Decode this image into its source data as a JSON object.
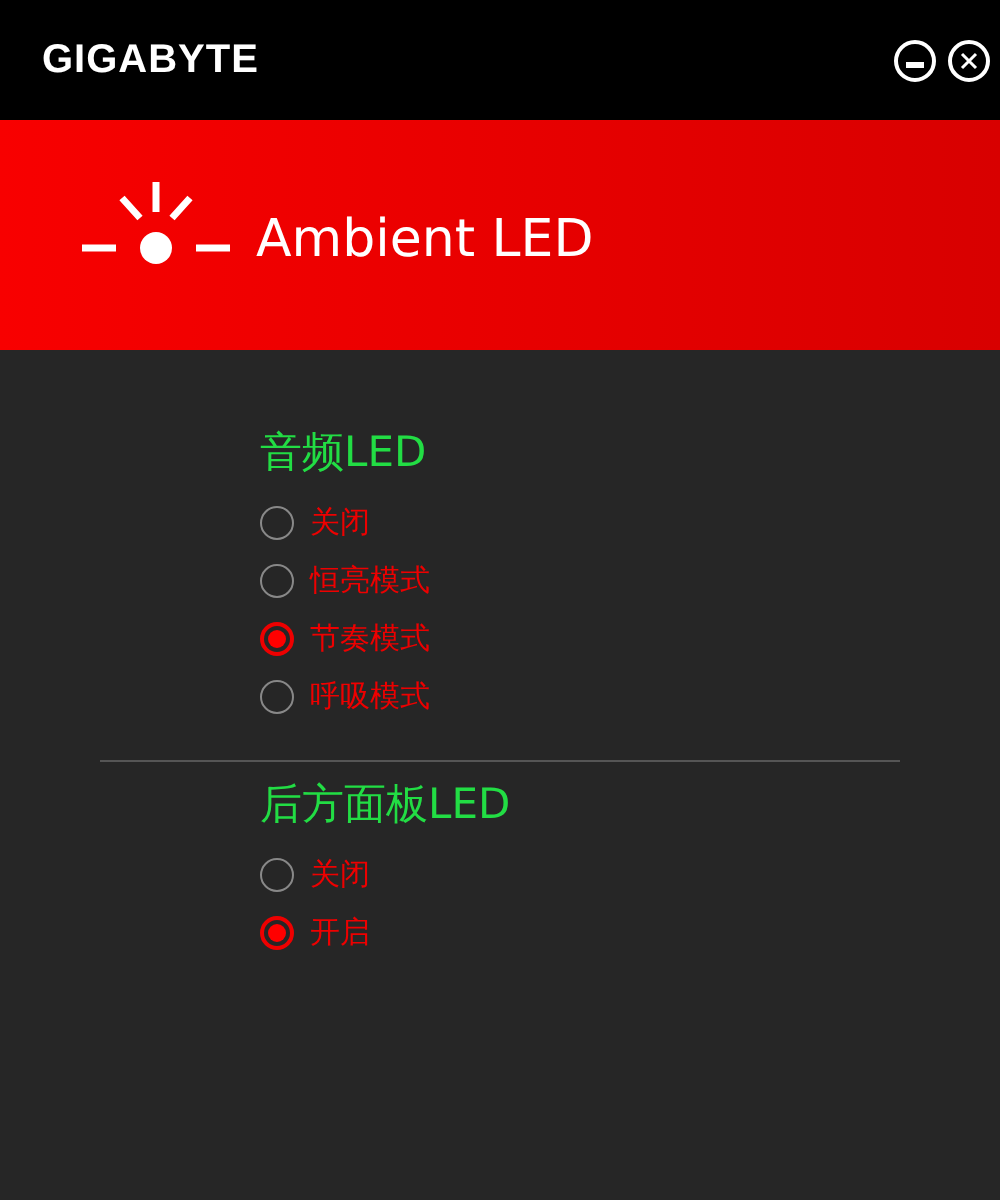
{
  "header": {
    "logo": "GIGABYTE"
  },
  "banner": {
    "title": "Ambient LED"
  },
  "sections": [
    {
      "title": "音频LED",
      "options": [
        {
          "label": "关闭",
          "selected": false
        },
        {
          "label": "恒亮模式",
          "selected": false
        },
        {
          "label": "节奏模式",
          "selected": true
        },
        {
          "label": "呼吸模式",
          "selected": false
        }
      ]
    },
    {
      "title": "后方面板LED",
      "options": [
        {
          "label": "关闭",
          "selected": false
        },
        {
          "label": "开启",
          "selected": true
        }
      ]
    }
  ]
}
